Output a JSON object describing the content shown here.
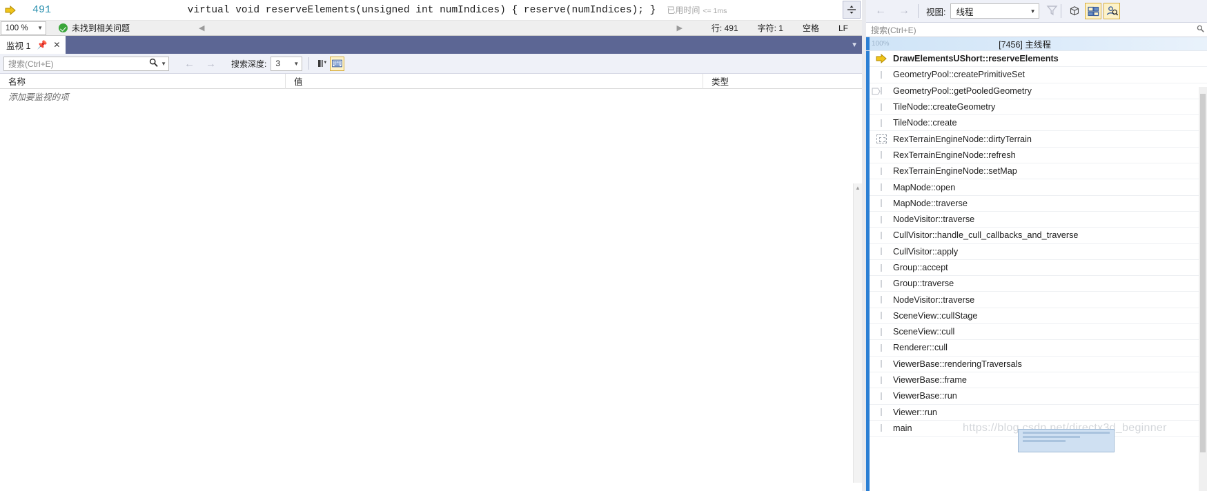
{
  "editor": {
    "current_line_marker": "execution-arrow",
    "line_number": "491",
    "code": "        virtual void reserveElements(unsigned int numIndices) { reserve(numIndices); }",
    "elapsed_label": "已用时间",
    "elapsed_value": "<= 1ms",
    "splitter_icon": "split-view-icon"
  },
  "editor_status": {
    "zoom": "100 %",
    "issue_text": "未找到相关问题",
    "ok_icon": "check-circle-icon",
    "nav_prev_icon": "triangle-left-icon",
    "nav_next_icon": "triangle-right-icon",
    "line_info": "行: 491",
    "char_info": "字符: 1",
    "indent_info": "空格",
    "eol_info": "LF"
  },
  "watch_panel": {
    "tab_label": "监视 1",
    "pin_icon": "pin-icon",
    "close_icon": "close-icon",
    "band_chevron_icon": "chevron-down-icon",
    "search_placeholder": "搜索(Ctrl+E)",
    "search_icon": "magnifier-icon",
    "search_dropdown_icon": "chevron-down-icon",
    "nav_back_icon": "arrow-left-icon",
    "nav_forward_icon": "arrow-right-icon",
    "depth_label": "搜索深度:",
    "depth_value": "3",
    "depth_caret_icon": "chevron-down-icon",
    "toolbar_buttons": [
      {
        "name": "hex-display-button",
        "icon": "hex-display-icon",
        "active": false
      },
      {
        "name": "keyboard-input-button",
        "icon": "keyboard-icon",
        "active": true
      }
    ],
    "columns": [
      "名称",
      "值",
      "类型"
    ],
    "empty_row_text": "添加要监视的项"
  },
  "callstack_panel": {
    "nav_back_icon": "arrow-left-icon",
    "nav_forward_icon": "arrow-right-icon",
    "view_label": "视图:",
    "view_value": "线程",
    "view_caret_icon": "chevron-down-icon",
    "filter_icon": "funnel-icon",
    "toolbar_buttons": [
      {
        "name": "module-toggle-button",
        "icon": "cube-box-icon",
        "active": false
      },
      {
        "name": "show-external-code-button",
        "icon": "frames-icon",
        "active": true
      },
      {
        "name": "search-callstack-button",
        "icon": "person-search-icon",
        "active": true
      }
    ],
    "search_placeholder": "搜索(Ctrl+E)",
    "search_icon": "magnifier-icon",
    "thread": {
      "percent": "100%",
      "title": "[7456] 主线程"
    },
    "frames": [
      {
        "name": "DrawElementsUShort::reserveElements",
        "current": true,
        "icon": "execution-arrow-icon"
      },
      {
        "name": "GeometryPool::createPrimitiveSet",
        "current": false,
        "icon": "tick-icon"
      },
      {
        "name": "GeometryPool::getPooledGeometry",
        "current": false,
        "icon": "tick-icon",
        "expander": true
      },
      {
        "name": "TileNode::createGeometry",
        "current": false,
        "icon": "tick-icon"
      },
      {
        "name": "TileNode::create",
        "current": false,
        "icon": "tick-icon"
      },
      {
        "name": "RexTerrainEngineNode::dirtyTerrain",
        "current": false,
        "icon": "non-user-code-icon"
      },
      {
        "name": "RexTerrainEngineNode::refresh",
        "current": false,
        "icon": "tick-icon"
      },
      {
        "name": "RexTerrainEngineNode::setMap",
        "current": false,
        "icon": "tick-icon"
      },
      {
        "name": "MapNode::open",
        "current": false,
        "icon": "tick-icon"
      },
      {
        "name": "MapNode::traverse",
        "current": false,
        "icon": "tick-icon"
      },
      {
        "name": "NodeVisitor::traverse",
        "current": false,
        "icon": "tick-icon"
      },
      {
        "name": "CullVisitor::handle_cull_callbacks_and_traverse",
        "current": false,
        "icon": "tick-icon"
      },
      {
        "name": "CullVisitor::apply",
        "current": false,
        "icon": "tick-icon"
      },
      {
        "name": "Group::accept",
        "current": false,
        "icon": "tick-icon"
      },
      {
        "name": "Group::traverse",
        "current": false,
        "icon": "tick-icon"
      },
      {
        "name": "NodeVisitor::traverse",
        "current": false,
        "icon": "tick-icon"
      },
      {
        "name": "SceneView::cullStage",
        "current": false,
        "icon": "tick-icon"
      },
      {
        "name": "SceneView::cull",
        "current": false,
        "icon": "tick-icon"
      },
      {
        "name": "Renderer::cull",
        "current": false,
        "icon": "tick-icon"
      },
      {
        "name": "ViewerBase::renderingTraversals",
        "current": false,
        "icon": "tick-icon"
      },
      {
        "name": "ViewerBase::frame",
        "current": false,
        "icon": "tick-icon"
      },
      {
        "name": "ViewerBase::run",
        "current": false,
        "icon": "tick-icon"
      },
      {
        "name": "Viewer::run",
        "current": false,
        "icon": "tick-icon"
      },
      {
        "name": "main",
        "current": false,
        "icon": "tick-icon"
      }
    ]
  },
  "watermark": {
    "text": "https://blog.csdn.net/directx3d_beginner"
  },
  "colors": {
    "accent_blue": "#2b7fd4",
    "band_purple": "#5c6694",
    "line_number_blue": "#2b91af",
    "toolbar_bg": "#eff1f8",
    "active_button_bg": "#fdf2c8",
    "active_button_border": "#d6ab3a",
    "ok_green": "#3aa63a"
  }
}
